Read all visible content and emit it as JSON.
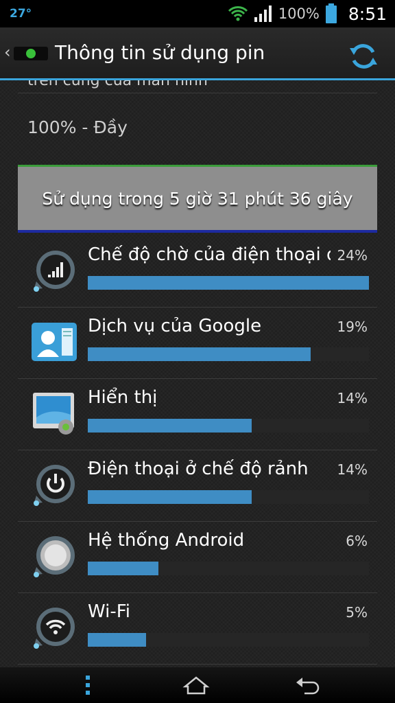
{
  "status_bar": {
    "temperature": "27°",
    "battery_percent": "100%",
    "time": "8:51"
  },
  "action_bar": {
    "title": "Thông tin sử dụng pin",
    "icons": [
      "back-chevron-icon",
      "app-logo-icon",
      "refresh-icon"
    ]
  },
  "content": {
    "cut_off_text": "trên cùng của màn hình",
    "battery_level": "100% - Đầy",
    "usage_summary": "Sử dụng trong 5 giờ 31 phút 36 giây"
  },
  "items": [
    {
      "name": "Chế độ chờ của điện thoại di động",
      "percent_label": "24%",
      "percent": 24,
      "icon": "cell-signal-icon"
    },
    {
      "name": "Dịch vụ của Google",
      "percent_label": "19%",
      "percent": 19,
      "icon": "google-services-icon"
    },
    {
      "name": "Hiển thị",
      "percent_label": "14%",
      "percent": 14,
      "icon": "display-icon"
    },
    {
      "name": "Điện thoại ở chế độ rảnh",
      "percent_label": "14%",
      "percent": 14,
      "icon": "power-icon"
    },
    {
      "name": "Hệ thống Android",
      "percent_label": "6%",
      "percent": 6,
      "icon": "android-system-icon"
    },
    {
      "name": "Wi-Fi",
      "percent_label": "5%",
      "percent": 5,
      "icon": "wifi-icon"
    }
  ],
  "nav_bar": {
    "icons": [
      "menu-icon",
      "home-icon",
      "back-icon"
    ]
  },
  "colors": {
    "accent": "#3aa5dc",
    "bar_fill": "#3f8dc4",
    "summary_bg": "#8e8e8e"
  }
}
